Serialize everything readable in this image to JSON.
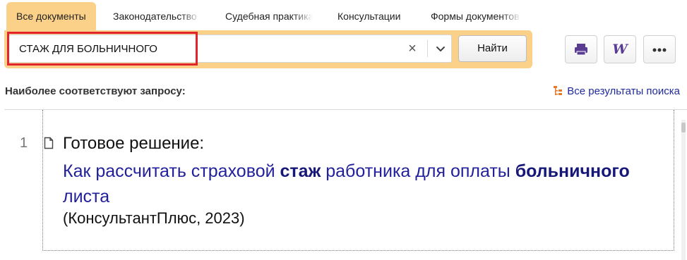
{
  "tabs": [
    {
      "label": "Все документы",
      "active": true
    },
    {
      "label": "Законодательство",
      "active": false
    },
    {
      "label": "Судебная практика",
      "active": false
    },
    {
      "label": "Консультации",
      "active": false
    },
    {
      "label": "Формы документов",
      "active": false
    }
  ],
  "search": {
    "query": "СТАЖ ДЛЯ БОЛЬНИЧНОГО",
    "clear_glyph": "×",
    "submit_label": "Найти"
  },
  "toolbar": {
    "print_icon": "printer-icon",
    "word_icon": "word-icon",
    "word_glyph": "W",
    "more_icon": "more-icon"
  },
  "results": {
    "heading": "Наиболее соответствуют запросу:",
    "all_results_label": "Все результаты поиска",
    "items": [
      {
        "number": "1",
        "label": "Готовое решение:",
        "title_parts": [
          {
            "text": "Как рассчитать страховой ",
            "bold": false
          },
          {
            "text": "стаж",
            "bold": true
          },
          {
            "text": " работника для оплаты ",
            "bold": false
          },
          {
            "text": "больничного",
            "bold": true
          },
          {
            "text": " листа",
            "bold": false
          }
        ],
        "source": "(КонсультантПлюс, 2023)"
      }
    ]
  },
  "colors": {
    "accent": "#fbd089",
    "highlight_border": "#e0262c",
    "link": "#22219b",
    "word_icon": "#5a3d93",
    "all_results_icon": "#e8792a"
  }
}
